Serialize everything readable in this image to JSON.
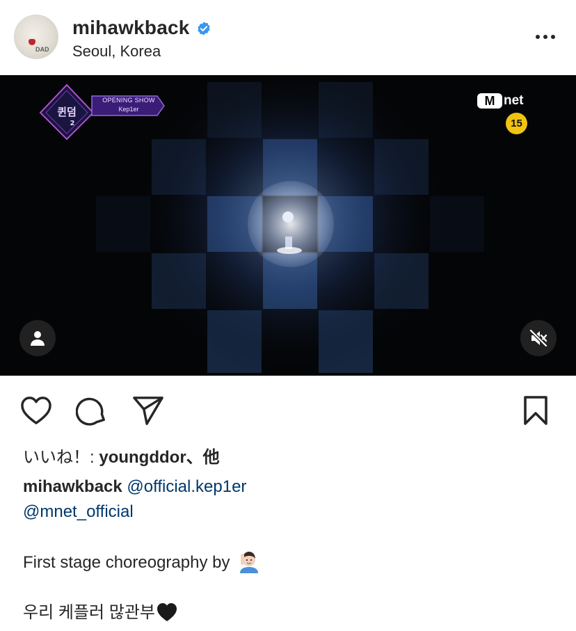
{
  "post": {
    "username": "mihawkback",
    "location": "Seoul, Korea",
    "verified_icon": "verified-badge-icon",
    "more_icon": "more-options-icon"
  },
  "media": {
    "show_logo": "퀸덤2",
    "badge_line1": "OPENING SHOW",
    "badge_line2": "Kep1er",
    "channel_m": "M",
    "channel_net": "net",
    "age_rating": "15",
    "tag_icon": "person-icon",
    "mute_icon": "speaker-muted-icon"
  },
  "actions": {
    "like_icon": "heart-icon",
    "comment_icon": "comment-bubble-icon",
    "share_icon": "paper-plane-icon",
    "save_icon": "bookmark-icon"
  },
  "likes": {
    "prefix": "いいね！: ",
    "user": "youngddor",
    "suffix": "、他"
  },
  "caption": {
    "username": "mihawkback",
    "mention1": "@official.kep1er",
    "mention2": "@mnet_official",
    "line3": "First stage choreography by",
    "line4": "우리 케플러 많관부"
  },
  "colors": {
    "text": "#262626",
    "mention": "#00376b",
    "verified": "#3897f0",
    "video_bg": "#040507"
  }
}
